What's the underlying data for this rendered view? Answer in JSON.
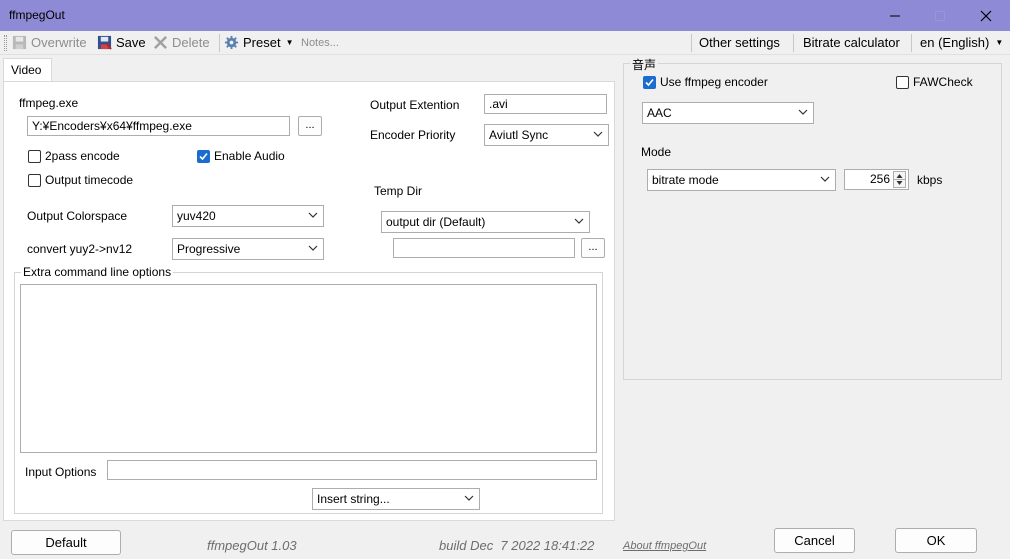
{
  "window": {
    "title": "ffmpegOut"
  },
  "toolbar": {
    "overwrite": "Overwrite",
    "save": "Save",
    "delete": "Delete",
    "preset": "Preset",
    "notes_placeholder": "Notes...",
    "other_settings": "Other settings",
    "bitrate_calculator": "Bitrate calculator",
    "language": "en (English)"
  },
  "tabs": [
    {
      "label": "Video"
    }
  ],
  "video": {
    "ffmpeg_exe_label": "ffmpeg.exe",
    "ffmpeg_path": "Y:¥Encoders¥x64¥ffmpeg.exe",
    "browse_label": "...",
    "output_extention_label": "Output Extention",
    "output_extention_value": ".avi",
    "encoder_priority_label": "Encoder Priority",
    "encoder_priority_value": "Aviutl Sync",
    "twopass_label": "2pass encode",
    "enable_audio_label": "Enable Audio",
    "output_timecode_label": "Output timecode",
    "temp_dir_label": "Temp Dir",
    "temp_dir_value": "output dir (Default)",
    "temp_dir_path": "",
    "output_colorspace_label": "Output Colorspace",
    "output_colorspace_value": "yuv420",
    "convert_label": "convert yuy2->nv12",
    "convert_value": "Progressive",
    "extra_options_label": "Extra command line options",
    "extra_options_value": "",
    "input_options_label": "Input Options",
    "input_options_value": "",
    "insert_string_value": "Insert string..."
  },
  "audio": {
    "group_label": "音声",
    "use_ffmpeg_label": "Use ffmpeg encoder",
    "fawcheck_label": "FAWCheck",
    "codec_value": "AAC",
    "mode_label": "Mode",
    "mode_value": "bitrate mode",
    "bitrate_value": "256",
    "bitrate_unit": "kbps"
  },
  "footer": {
    "default_label": "Default",
    "version": "ffmpegOut 1.03",
    "build": "build Dec  7 2022 18:41:22",
    "about": "About ffmpegOut",
    "cancel_label": "Cancel",
    "ok_label": "OK"
  },
  "state": {
    "twopass_checked": false,
    "enable_audio_checked": true,
    "output_timecode_checked": false,
    "use_ffmpeg_checked": true,
    "fawcheck_checked": false
  },
  "colors": {
    "titlebar": "#8f8ad6",
    "checkbox_on": "#1c6ccf"
  }
}
